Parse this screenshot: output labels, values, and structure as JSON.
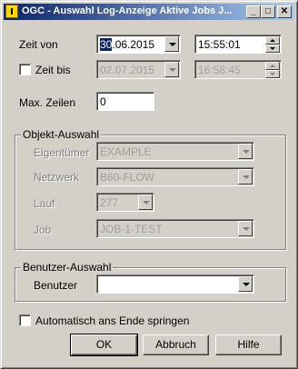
{
  "window": {
    "title": "OGC - Auswahl Log-Anzeige Aktive Jobs J...",
    "minimize_label": "_",
    "maximize_label": "□",
    "close_label": "✕"
  },
  "zeit_von": {
    "label": "Zeit von",
    "date_selected_part": "30",
    "date_rest": ".06.2015",
    "time": "15:55:01"
  },
  "zeit_bis": {
    "label": "Zeit bis",
    "date": "02.07.2015",
    "time": "16:58:45"
  },
  "max_zeilen": {
    "label": "Max. Zeilen",
    "value": "0"
  },
  "objekt_auswahl": {
    "title": "Objekt-Auswahl",
    "eigentuemer_label": "Eigentümer",
    "eigentuemer_value": "EXAMPLE",
    "netzwerk_label": "Netzwerk",
    "netzwerk_value": "B60-FLOW",
    "lauf_label": "Lauf",
    "lauf_value": "277",
    "job_label": "Job",
    "job_value": "JOB-1-TEST"
  },
  "benutzer_auswahl": {
    "title": "Benutzer-Auswahl",
    "benutzer_label": "Benutzer",
    "benutzer_value": ""
  },
  "auto_end": {
    "label": "Automatisch ans Ende springen"
  },
  "buttons": {
    "ok": "OK",
    "abbruch": "Abbruch",
    "hilfe": "Hilfe"
  }
}
